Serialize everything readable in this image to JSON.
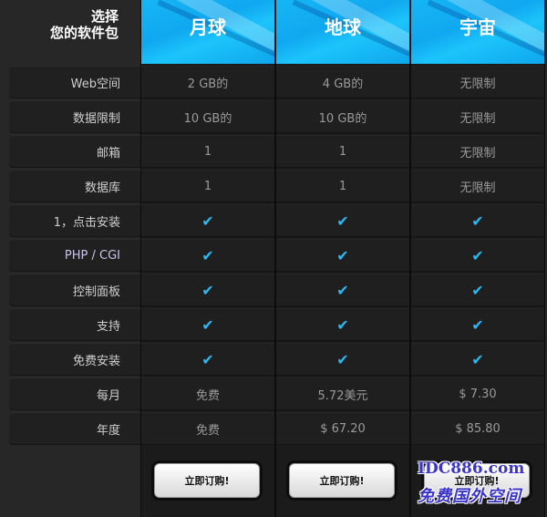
{
  "corner": {
    "line1": "选择",
    "line2": "您的软件包"
  },
  "features": [
    {
      "label": "Web空间"
    },
    {
      "label": "数据限制"
    },
    {
      "label": "邮箱"
    },
    {
      "label": "数据库"
    },
    {
      "label": "1，点击安装"
    },
    {
      "label": "PHP / CGI"
    },
    {
      "label": "控制面板"
    },
    {
      "label": "支持"
    },
    {
      "label": "免费安装"
    },
    {
      "label": "每月"
    },
    {
      "label": "年度"
    }
  ],
  "plans": [
    {
      "name": "月球",
      "values": [
        "2 GB的",
        "10 GB的",
        "1",
        "1",
        "✔",
        "✔",
        "✔",
        "✔",
        "✔",
        "免费",
        "免费"
      ],
      "order_label": "立即订购!"
    },
    {
      "name": "地球",
      "values": [
        "4 GB的",
        "10 GB的",
        "1",
        "1",
        "✔",
        "✔",
        "✔",
        "✔",
        "✔",
        "5.72美元",
        "$ 67.20"
      ],
      "order_label": "立即订购!"
    },
    {
      "name": "宇宙",
      "values": [
        "无限制",
        "无限制",
        "无限制",
        "无限制",
        "✔",
        "✔",
        "✔",
        "✔",
        "✔",
        "$ 7.30",
        "$ 85.80"
      ],
      "order_label": "立即订购!"
    }
  ],
  "watermark": {
    "line1": "IDC886.com",
    "line2": "免费国外空间"
  },
  "colors": {
    "header_blue": "#16b6f5",
    "check": "#2fb8f0"
  }
}
